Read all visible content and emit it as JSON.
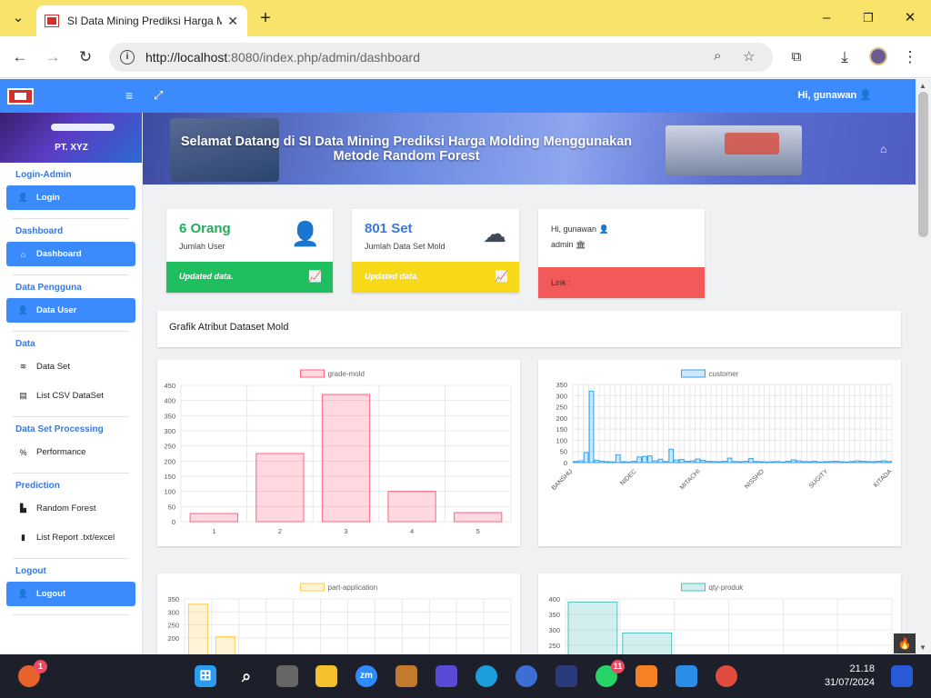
{
  "browser": {
    "tab_title": "SI Data Mining Prediksi Harga M",
    "url_host": "http://localhost",
    "url_rest": ":8080/index.php/admin/dashboard"
  },
  "header": {
    "greeting": "Hi, gunawan"
  },
  "sidebar": {
    "company": "PT. XYZ",
    "sections": [
      {
        "title": "Login-Admin",
        "items": [
          {
            "label": "Login",
            "icon": "user-icon",
            "active": true
          }
        ]
      },
      {
        "title": "Dashboard",
        "items": [
          {
            "label": "Dashboard",
            "icon": "home-icon",
            "active": true
          }
        ]
      },
      {
        "title": "Data Pengguna",
        "items": [
          {
            "label": "Data User",
            "icon": "user-plus-icon",
            "active": true
          }
        ]
      },
      {
        "title": "Data",
        "items": [
          {
            "label": "Data Set",
            "icon": "database-icon",
            "active": false
          },
          {
            "label": "List CSV DataSet",
            "icon": "table-icon",
            "active": false
          }
        ]
      },
      {
        "title": "Data Set Processing",
        "items": [
          {
            "label": "Performance",
            "icon": "percent-icon",
            "active": false
          }
        ]
      },
      {
        "title": "Prediction",
        "items": [
          {
            "label": "Random Forest",
            "icon": "chart-icon",
            "active": false
          },
          {
            "label": "List Report .txt/excel",
            "icon": "file-icon",
            "active": false
          }
        ]
      },
      {
        "title": "Logout",
        "items": [
          {
            "label": "Logout",
            "icon": "user-icon",
            "active": true
          }
        ]
      }
    ]
  },
  "banner": {
    "title": "Selamat Datang di SI Data Mining Prediksi Harga Molding Menggunakan Metode Random Forest"
  },
  "cards": {
    "users": {
      "value": "6 Orang",
      "label": "Jumlah User",
      "footer": "Updated data.",
      "color": "#1fbf5f"
    },
    "datasets": {
      "value": "801 Set",
      "label": "Jumlah Data Set Mold",
      "footer": "Updated data.",
      "color": "#f7d917"
    },
    "profile": {
      "greeting": "Hi, gunawan",
      "role": "admin",
      "footer": "Link :",
      "color": "#f25a5a"
    }
  },
  "section_title": "Grafik Atribut Dataset Mold",
  "chart_data": [
    {
      "type": "bar",
      "legend": "grade-mold",
      "categories": [
        "1",
        "2",
        "3",
        "4",
        "5"
      ],
      "values": [
        27,
        225,
        420,
        100,
        30
      ],
      "ylim": [
        0,
        450
      ],
      "yticks": [
        0,
        50,
        100,
        150,
        200,
        250,
        300,
        350,
        400,
        450
      ],
      "color": "#ff6384"
    },
    {
      "type": "bar",
      "legend": "customer",
      "xticks": [
        "BANSHU",
        "NIDEC",
        "MITACHI",
        "NISSHO",
        "SUGITY",
        "KITADA"
      ],
      "values": [
        5,
        8,
        45,
        320,
        10,
        6,
        4,
        3,
        35,
        4,
        3,
        6,
        25,
        28,
        30,
        8,
        15,
        5,
        60,
        12,
        14,
        6,
        8,
        16,
        10,
        6,
        5,
        4,
        6,
        20,
        5,
        4,
        6,
        18,
        5,
        4,
        3,
        4,
        5,
        3,
        6,
        12,
        8,
        5,
        4,
        6,
        3,
        4,
        5,
        6,
        4,
        3,
        5,
        8,
        6,
        5,
        4,
        6,
        8,
        5
      ],
      "ylim": [
        0,
        350
      ],
      "yticks": [
        0,
        50,
        100,
        150,
        200,
        250,
        300,
        350
      ],
      "color": "#36a2eb"
    },
    {
      "type": "bar",
      "legend": "part-application",
      "values": [
        330,
        205
      ],
      "ylim": [
        0,
        350
      ],
      "yticks": [
        200,
        250,
        300,
        350
      ],
      "color": "#ffce56"
    },
    {
      "type": "bar",
      "legend": "qty-produk",
      "values": [
        390,
        290
      ],
      "ylim": [
        0,
        400
      ],
      "yticks": [
        250,
        300,
        350,
        400
      ],
      "color": "#4bc0c0"
    }
  ],
  "taskbar": {
    "time": "21.18",
    "date": "31/07/2024",
    "badges": {
      "app1": "1",
      "whatsapp": "11"
    },
    "apps": [
      "zm"
    ]
  }
}
